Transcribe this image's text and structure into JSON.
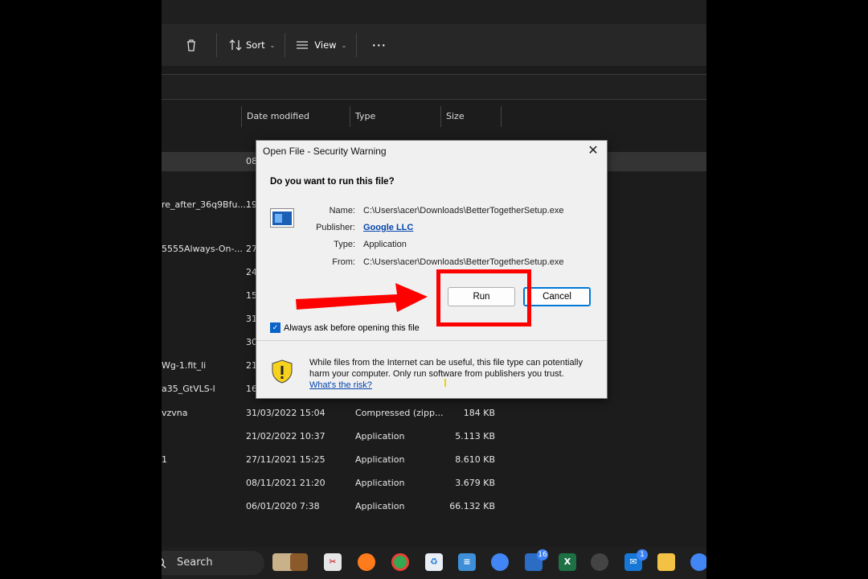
{
  "explorer": {
    "toolbar": {
      "sort_label": "Sort",
      "view_label": "View"
    },
    "columns": [
      "Date modified",
      "Type",
      "Size"
    ],
    "rows": [
      {
        "name": "",
        "date": "08",
        "type": "",
        "size": ""
      },
      {
        "name": "re_after_36q9Bfu....",
        "date": "19",
        "type": "",
        "size": ""
      },
      {
        "name": "5555Always-On-...",
        "date": "27",
        "type": "",
        "size": ""
      },
      {
        "name": "",
        "date": "24",
        "type": "",
        "size": ""
      },
      {
        "name": "",
        "date": "15",
        "type": "",
        "size": ""
      },
      {
        "name": "",
        "date": "31",
        "type": "",
        "size": ""
      },
      {
        "name": "",
        "date": "30",
        "type": "",
        "size": ""
      },
      {
        "name": "Wg-1.fit_li",
        "date": "21",
        "type": "",
        "size": ""
      },
      {
        "name": "a35_GtVLS-l",
        "date": "16",
        "type": "",
        "size": ""
      },
      {
        "name": "vzvna",
        "date": "31/03/2022 15:04",
        "type": "Compressed (zipp...",
        "size": "184 KB"
      },
      {
        "name": "",
        "date": "21/02/2022 10:37",
        "type": "Application",
        "size": "5.113 KB"
      },
      {
        "name": "1",
        "date": "27/11/2021 15:25",
        "type": "Application",
        "size": "8.610 KB"
      },
      {
        "name": "",
        "date": "08/11/2021 21:20",
        "type": "Application",
        "size": "3.679 KB"
      },
      {
        "name": "",
        "date": "06/01/2020 7:38",
        "type": "Application",
        "size": "66.132 KB"
      }
    ]
  },
  "taskbar": {
    "search_label": "Search",
    "badges": {
      "teams": "16",
      "mail": "1"
    }
  },
  "dialog": {
    "title": "Open File - Security Warning",
    "question": "Do you want to run this file?",
    "fields": {
      "name_label": "Name:",
      "name_value": "C:\\Users\\acer\\Downloads\\BetterTogetherSetup.exe",
      "publisher_label": "Publisher:",
      "publisher_value": "Google LLC",
      "type_label": "Type:",
      "type_value": "Application",
      "from_label": "From:",
      "from_value": "C:\\Users\\acer\\Downloads\\BetterTogetherSetup.exe"
    },
    "run_label": "Run",
    "cancel_label": "Cancel",
    "checkbox_label": "Always ask before opening this file",
    "checkbox_checked": true,
    "warning_text": "While files from the Internet can be useful, this file type can potentially harm your computer. Only run software from publishers you trust.",
    "warning_link": "What's the risk?"
  },
  "colors": {
    "annotation": "#ff0000",
    "accent": "#0078d7",
    "link": "#0645ad"
  }
}
